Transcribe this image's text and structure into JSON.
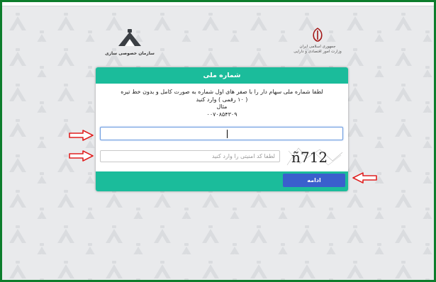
{
  "header": {
    "left_logo_caption": "سازمان خصوصی سازی",
    "right_logo_line1": "جمهوری اسلامی ایران",
    "right_logo_line2": "وزارت امور اقتصادی و دارایی"
  },
  "form": {
    "title": "شماره ملی",
    "instruction_line1": "لطفا شماره ملی سهام دار را با صفر های اول شماره به صورت کامل و بدون خط تیره",
    "instruction_line2": "( ۱۰ رقمی ) وارد کنید",
    "example_label": "مثال",
    "example_value": "۰۰۷۰۸۵۴۳۰۹",
    "national_id_value": "",
    "captcha_placeholder": "لطفا کد امنیتی را وارد کنید",
    "captcha_text": "ñ712",
    "submit_label": "ادامه"
  },
  "colors": {
    "frame_green": "#0d7d2c",
    "header_teal": "#1bbc9b",
    "button_blue": "#3a5fcd",
    "arrow_red": "#e02020"
  },
  "icons": {
    "right_logo": "iran-emblem-icon",
    "left_logo": "privatization-org-logo-icon",
    "annotation": "red-arrow-icon"
  }
}
